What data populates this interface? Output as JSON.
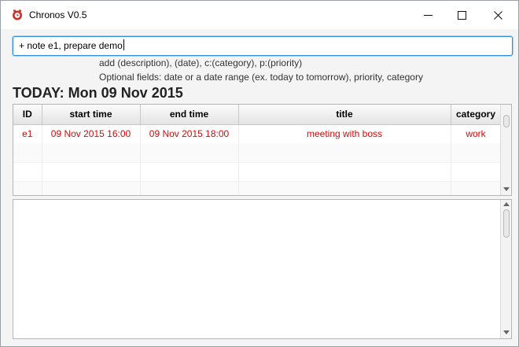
{
  "window": {
    "title": "Chronos V0.5"
  },
  "command": {
    "value": "+ note e1, prepare demo"
  },
  "hints": {
    "line1": "add (description), (date), c:(category), p:(priority)",
    "line2": "Optional fields: date or a date range (ex. today to tomorrow), priority, category"
  },
  "today_header": "TODAY: Mon 09 Nov 2015",
  "table": {
    "columns": [
      "ID",
      "start time",
      "end time",
      "title",
      "category"
    ],
    "rows": [
      {
        "id": "e1",
        "start": "09 Nov 2015 16:00",
        "end": "09 Nov 2015 18:00",
        "title": "meeting with boss",
        "category": "work"
      }
    ]
  },
  "colors": {
    "accent": "#2f8fd8",
    "event_text": "#d10a0a",
    "app_icon": "#c8322b"
  },
  "icons": {
    "app": "chronos-app-icon",
    "minimize": "minimize-icon",
    "maximize": "maximize-icon",
    "close": "close-icon"
  }
}
